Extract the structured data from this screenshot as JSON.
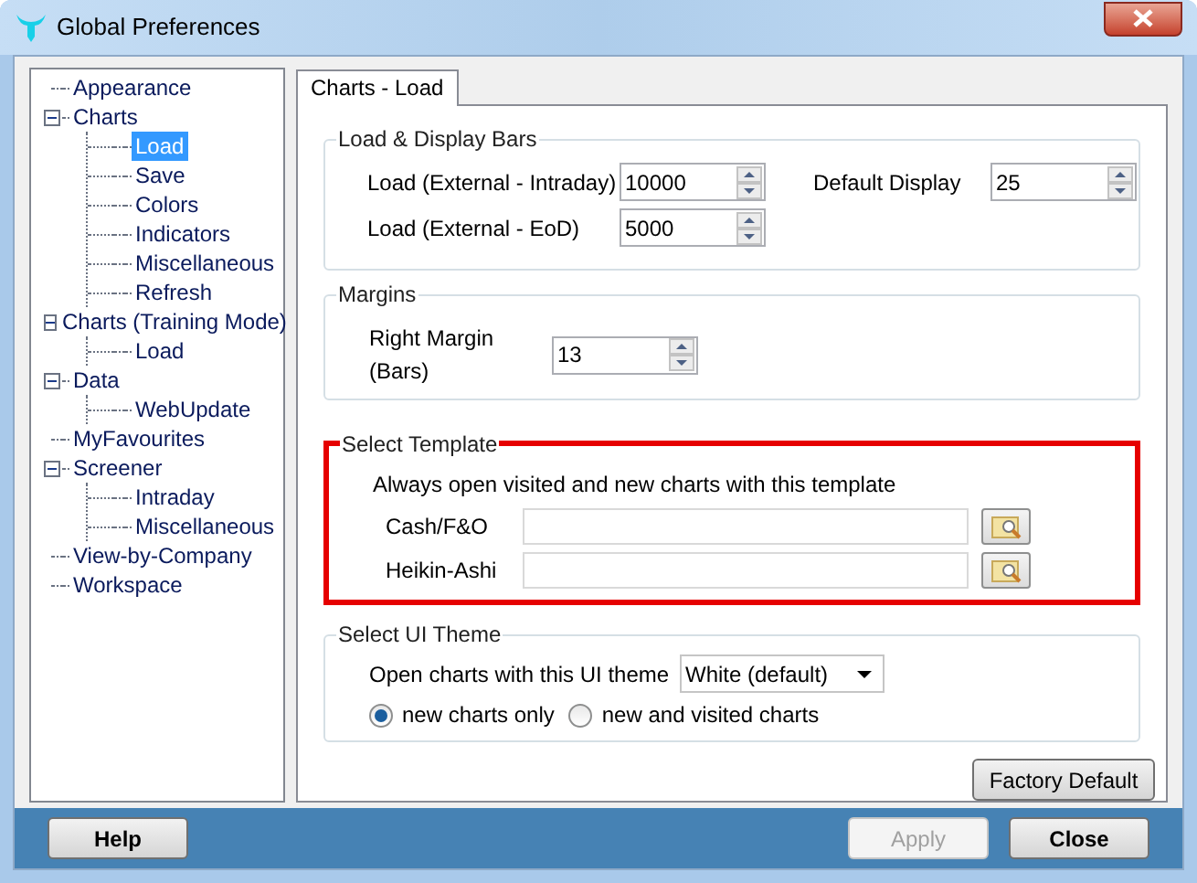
{
  "window": {
    "title": "Global Preferences"
  },
  "tree": [
    {
      "label": "Appearance",
      "selected": false
    },
    {
      "label": "Charts",
      "selected": false,
      "expanded": true,
      "children": [
        {
          "label": "Load",
          "selected": true
        },
        {
          "label": "Save",
          "selected": false
        },
        {
          "label": "Colors",
          "selected": false
        },
        {
          "label": "Indicators",
          "selected": false
        },
        {
          "label": "Miscellaneous",
          "selected": false
        },
        {
          "label": "Refresh",
          "selected": false
        }
      ]
    },
    {
      "label": "Charts (Training Mode)",
      "selected": false,
      "expanded": true,
      "children": [
        {
          "label": "Load",
          "selected": false
        }
      ]
    },
    {
      "label": "Data",
      "selected": false,
      "expanded": true,
      "children": [
        {
          "label": "WebUpdate",
          "selected": false
        }
      ]
    },
    {
      "label": "MyFavourites",
      "selected": false
    },
    {
      "label": "Screener",
      "selected": false,
      "expanded": true,
      "children": [
        {
          "label": "Intraday",
          "selected": false
        },
        {
          "label": "Miscellaneous",
          "selected": false
        }
      ]
    },
    {
      "label": "View-by-Company",
      "selected": false
    },
    {
      "label": "Workspace",
      "selected": false
    }
  ],
  "tabs": [
    {
      "label": "Charts - Load",
      "selected": true
    }
  ],
  "load_display_bars": {
    "title": "Load & Display Bars",
    "fields": [
      {
        "label": "Load (External - Intraday)",
        "value": "10000"
      },
      {
        "label": "Load (External - EoD)",
        "value": "5000"
      }
    ],
    "default_display": {
      "label": "Default Display",
      "value": "25"
    }
  },
  "margins": {
    "title": "Margins",
    "fields": [
      {
        "label": "Right Margin (Bars)",
        "value": "13"
      }
    ]
  },
  "select_template": {
    "title": "Select Template",
    "highlighted": true,
    "description": "Always open visited and new charts with this template",
    "fields": [
      {
        "label": "Cash/F&O"
      },
      {
        "label": "Heikin-Ashi"
      }
    ]
  },
  "ui_theme": {
    "title": "Select UI Theme",
    "label": "Open charts with this UI theme",
    "value": "White (default)",
    "options": [
      {
        "label": "new charts only",
        "selected": true
      },
      {
        "label": "new and visited charts",
        "selected": false
      }
    ]
  },
  "factory_default": "Factory Default",
  "buttons": [
    {
      "label": "Help",
      "disabled": false
    },
    {
      "label": "Apply",
      "disabled": true
    },
    {
      "label": "Close",
      "disabled": false
    }
  ]
}
